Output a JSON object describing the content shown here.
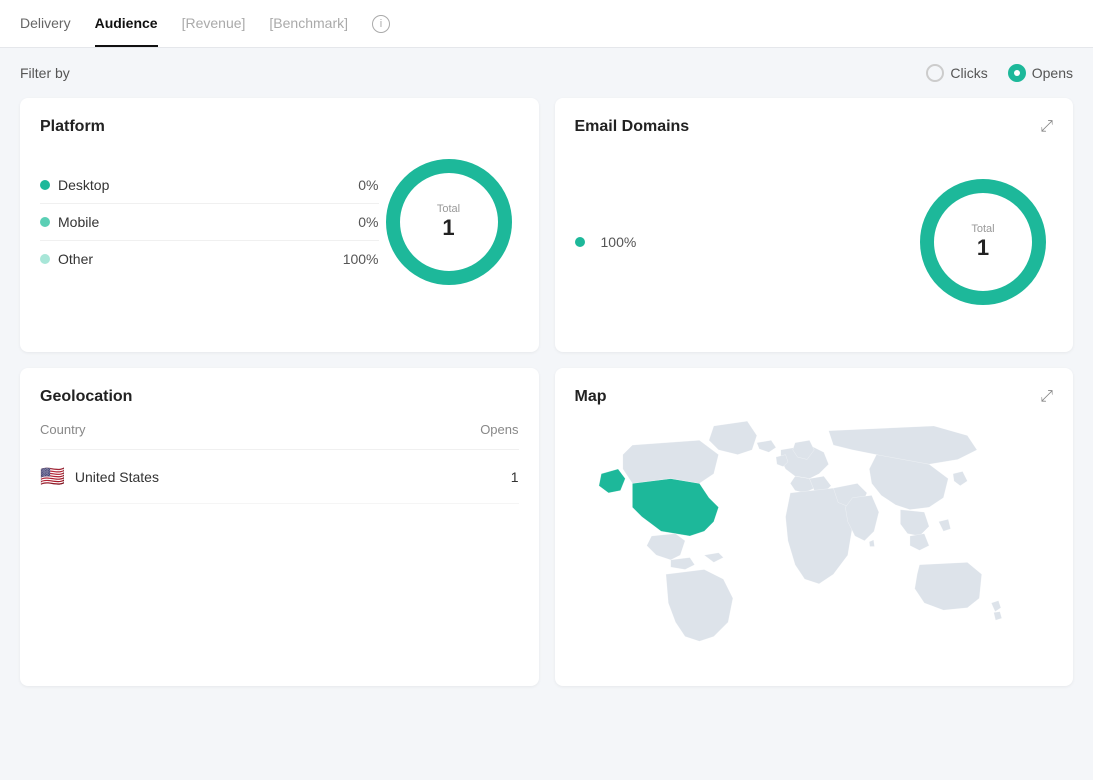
{
  "nav": {
    "items": [
      {
        "label": "Delivery",
        "active": false,
        "disabled": false
      },
      {
        "label": "Audience",
        "active": true,
        "disabled": false
      },
      {
        "label": "[Revenue]",
        "active": false,
        "disabled": true
      },
      {
        "label": "[Benchmark]",
        "active": false,
        "disabled": true
      }
    ],
    "info_icon_label": "i"
  },
  "filter": {
    "label": "Filter by",
    "options": [
      {
        "label": "Clicks",
        "active": false
      },
      {
        "label": "Opens",
        "active": true
      }
    ]
  },
  "platform": {
    "title": "Platform",
    "items": [
      {
        "label": "Desktop",
        "pct": "0%",
        "dot": "teal"
      },
      {
        "label": "Mobile",
        "pct": "0%",
        "dot": "teal2"
      },
      {
        "label": "Other",
        "pct": "100%",
        "dot": "teal3"
      }
    ],
    "donut": {
      "total_label": "Total",
      "total_value": "1",
      "segments": [
        {
          "value": 0,
          "color": "#1db89a"
        },
        {
          "value": 0,
          "color": "#5bcfb5"
        },
        {
          "value": 100,
          "color": "#a8e6d8"
        }
      ]
    }
  },
  "email_domains": {
    "title": "Email Domains",
    "items": [
      {
        "label": "",
        "pct": "100%",
        "dot": "teal"
      }
    ],
    "donut": {
      "total_label": "Total",
      "total_value": "1"
    }
  },
  "geolocation": {
    "title": "Geolocation",
    "table": {
      "headers": [
        "Country",
        "Opens"
      ],
      "rows": [
        {
          "country": "United States",
          "flag": "🇺🇸",
          "opens": "1"
        }
      ]
    }
  },
  "map": {
    "title": "Map"
  }
}
